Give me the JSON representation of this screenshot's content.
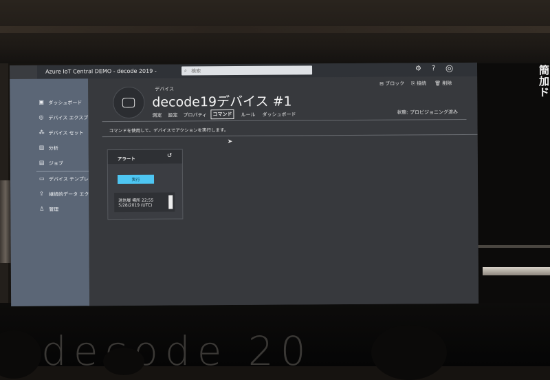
{
  "app": {
    "title": "Azure IoT Central DEMO - decode 2019 -",
    "search_placeholder": "検索"
  },
  "topbar_icons": [
    "gear-icon",
    "help-icon",
    "account-icon"
  ],
  "sidebar": {
    "items": [
      {
        "label": "ダッシュボード",
        "icon": "dashboard-icon"
      },
      {
        "label": "デバイス エクスプロー...",
        "icon": "device-explorer-icon"
      },
      {
        "label": "デバイス セット",
        "icon": "device-set-icon"
      },
      {
        "label": "分析",
        "icon": "analytics-icon"
      },
      {
        "label": "ジョブ",
        "icon": "jobs-icon"
      },
      {
        "label": "デバイス テンプレート",
        "icon": "device-template-icon"
      },
      {
        "label": "継続的データ エクスポ...",
        "icon": "data-export-icon"
      },
      {
        "label": "管理",
        "icon": "admin-icon"
      }
    ]
  },
  "device": {
    "type_label": "デバイス",
    "name": "decode19デバイス #1",
    "actions": [
      {
        "label": "ブロック",
        "icon": "block-icon"
      },
      {
        "label": "接続",
        "icon": "connect-icon"
      },
      {
        "label": "削除",
        "icon": "delete-icon"
      }
    ],
    "tabs": [
      "測定",
      "設定",
      "プロパティ",
      "コマンド",
      "ルール",
      "ダッシュボード"
    ],
    "active_tab": "コマンド",
    "status": "状態: プロビジョニング済み"
  },
  "commands": {
    "help_text": "コマンドを使用して、デバイスでアクションを実行します。",
    "card": {
      "title": "アラート",
      "run_label": "実行",
      "result_line1": "送信履 場所 22:55",
      "result_line2": "5/28/2019 (UTC)"
    }
  },
  "venue": {
    "right_text": [
      "簡",
      "加",
      "ド"
    ],
    "brand_text": "decode 20"
  },
  "colors": {
    "sidebar": "#5b6676",
    "topbar": "#2f3237",
    "main": "#37393d",
    "accent": "#4ec6f2"
  }
}
